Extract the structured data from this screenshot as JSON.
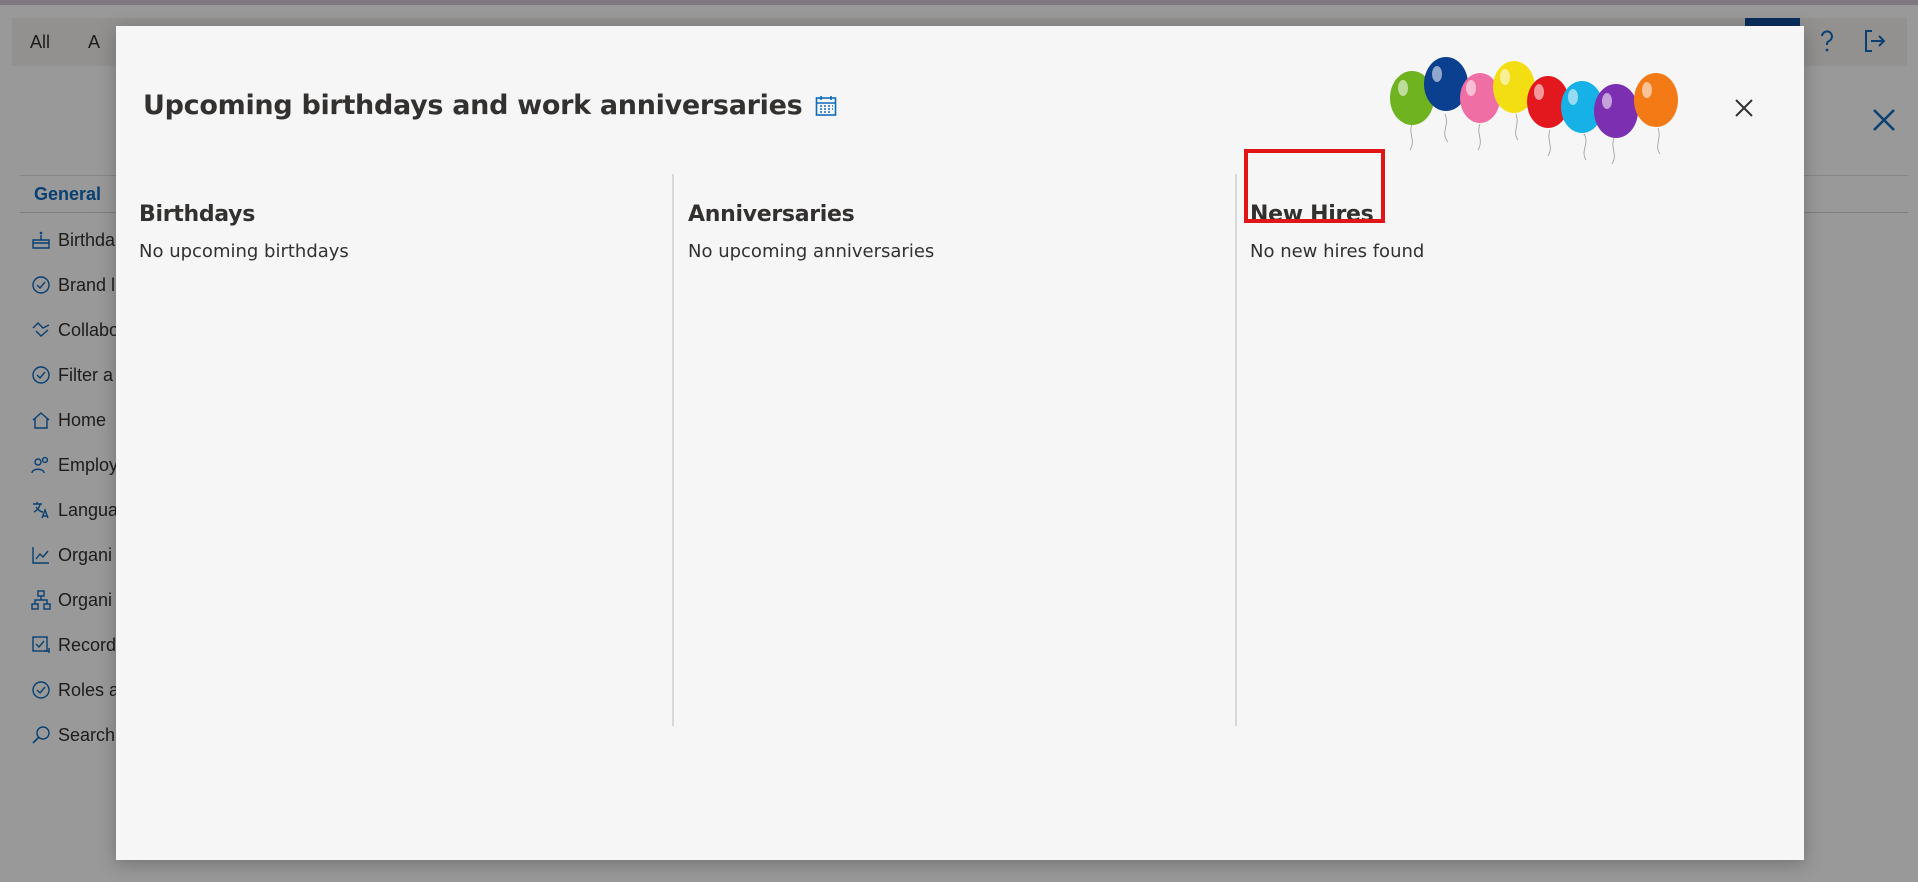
{
  "background": {
    "tabs": [
      "All",
      "A"
    ],
    "section_tab": "General",
    "list_items": [
      {
        "label": "Birthda",
        "icon": "cake-icon"
      },
      {
        "label": "Brand l",
        "icon": "badge-icon"
      },
      {
        "label": "Collabo",
        "icon": "handshake-icon"
      },
      {
        "label": "Filter a",
        "icon": "badge-icon"
      },
      {
        "label": "Home",
        "icon": "home-icon"
      },
      {
        "label": "Employ",
        "icon": "people-icon"
      },
      {
        "label": "Langua",
        "icon": "language-icon"
      },
      {
        "label": "Organi",
        "icon": "chart-icon"
      },
      {
        "label": "Organi",
        "icon": "org-chart-icon"
      },
      {
        "label": "Record",
        "icon": "checklist-icon"
      },
      {
        "label": "Roles a",
        "icon": "badge-icon"
      },
      {
        "label": "Search",
        "icon": "search-icon"
      }
    ],
    "help_icon": "question-icon",
    "signout_icon": "sign-out-icon",
    "close_icon": "close-icon"
  },
  "modal": {
    "title": "Upcoming birthdays and work anniversaries",
    "title_icon": "calendar-icon",
    "close_icon": "close-icon",
    "decoration": "balloons",
    "columns": [
      {
        "heading": "Birthdays",
        "message": "No upcoming birthdays"
      },
      {
        "heading": "Anniversaries",
        "message": "No upcoming anniversaries"
      },
      {
        "heading": "New Hires",
        "message": "No new hires found"
      }
    ],
    "highlight_color": "#e01515"
  },
  "colors": {
    "accent": "#0f6cbd",
    "overlay": "rgba(0,0,0,0.40)",
    "modal_bg": "#f6f6f6"
  }
}
